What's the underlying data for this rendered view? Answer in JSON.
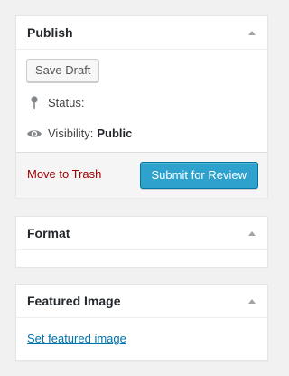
{
  "publish": {
    "title": "Publish",
    "save_draft_label": "Save Draft",
    "status_label": "Status:",
    "visibility_label": "Visibility:",
    "visibility_value": "Public",
    "move_to_trash_label": "Move to Trash",
    "submit_label": "Submit for Review"
  },
  "format": {
    "title": "Format"
  },
  "featured_image": {
    "title": "Featured Image",
    "set_link_label": "Set featured image"
  },
  "icons": {
    "toggle": "triangle-up-icon",
    "status": "pin-icon",
    "visibility": "eye-icon"
  },
  "colors": {
    "primary_button": "#2ea2cc",
    "trash_link": "#a00000",
    "link": "#0073aa"
  }
}
